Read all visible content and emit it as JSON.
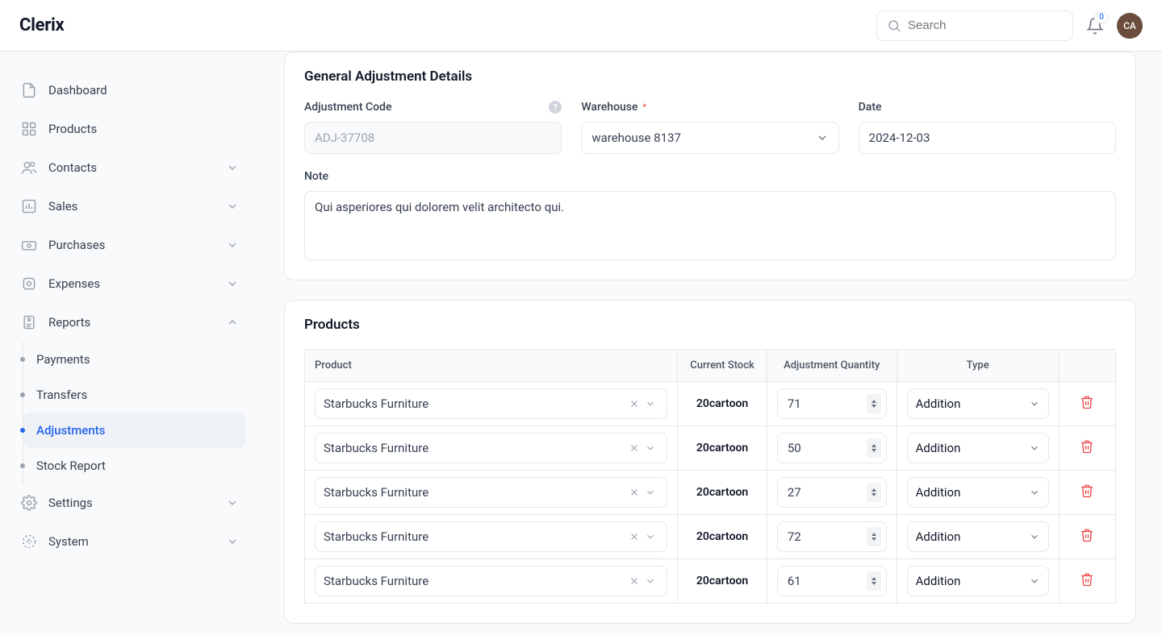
{
  "brand": "Clerix",
  "search": {
    "placeholder": "Search"
  },
  "notifications": {
    "count": "0"
  },
  "avatar": "CA",
  "sidebar": {
    "items": [
      {
        "label": "Dashboard"
      },
      {
        "label": "Products"
      },
      {
        "label": "Contacts"
      },
      {
        "label": "Sales"
      },
      {
        "label": "Purchases"
      },
      {
        "label": "Expenses"
      },
      {
        "label": "Reports"
      },
      {
        "label": "Settings"
      },
      {
        "label": "System"
      }
    ],
    "reports_sub": [
      {
        "label": "Payments"
      },
      {
        "label": "Transfers"
      },
      {
        "label": "Adjustments"
      },
      {
        "label": "Stock Report"
      }
    ]
  },
  "general": {
    "title": "General Adjustment Details",
    "fields": {
      "code_label": "Adjustment Code",
      "code_value": "ADJ-37708",
      "warehouse_label": "Warehouse",
      "warehouse_value": "warehouse 8137",
      "date_label": "Date",
      "date_value": "2024-12-03",
      "note_label": "Note",
      "note_value": "Qui asperiores qui dolorem velit architecto qui."
    }
  },
  "products": {
    "title": "Products",
    "columns": {
      "product": "Product",
      "stock": "Current Stock",
      "qty": "Adjustment Quantity",
      "type": "Type"
    },
    "rows": [
      {
        "product": "Starbucks Furniture",
        "stock": "20cartoon",
        "qty": "71",
        "type": "Addition"
      },
      {
        "product": "Starbucks Furniture",
        "stock": "20cartoon",
        "qty": "50",
        "type": "Addition"
      },
      {
        "product": "Starbucks Furniture",
        "stock": "20cartoon",
        "qty": "27",
        "type": "Addition"
      },
      {
        "product": "Starbucks Furniture",
        "stock": "20cartoon",
        "qty": "72",
        "type": "Addition"
      },
      {
        "product": "Starbucks Furniture",
        "stock": "20cartoon",
        "qty": "61",
        "type": "Addition"
      }
    ]
  }
}
